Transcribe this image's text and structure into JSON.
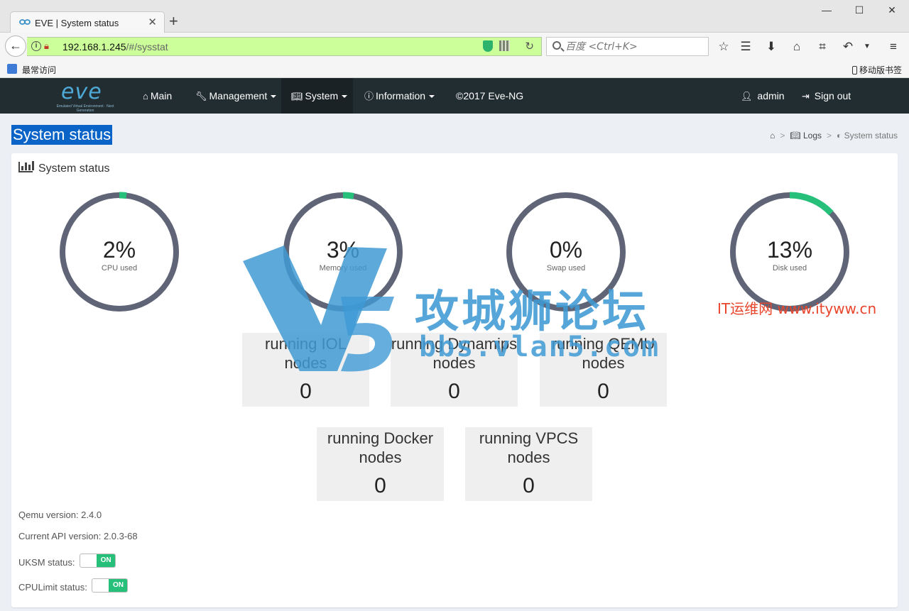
{
  "browser": {
    "tab_title": "EVE | System status",
    "url_host": "192.168.1.245",
    "url_path": "/#/sysstat",
    "search_placeholder": "百度 <Ctrl+K>",
    "bookmark_label": "最常访问",
    "mobile_bookmarks": "移动版书签"
  },
  "nav": {
    "main": "Main",
    "management": "Management",
    "system": "System",
    "information": "Information",
    "copyright": "©2017 Eve-NG",
    "user": "admin",
    "signout": "Sign out"
  },
  "page": {
    "title": "System status",
    "breadcrumb": {
      "logs": "Logs",
      "current": "System status"
    },
    "box_title": "System status"
  },
  "gauges": [
    {
      "value": "2%",
      "label": "CPU used",
      "percent": 2
    },
    {
      "value": "3%",
      "label": "Memory used",
      "percent": 3
    },
    {
      "value": "0%",
      "label": "Swap used",
      "percent": 0
    },
    {
      "value": "13%",
      "label": "Disk used",
      "percent": 13
    }
  ],
  "counters": [
    {
      "label": "running IOL nodes",
      "value": "0"
    },
    {
      "label": "running Dynamips nodes",
      "value": "0"
    },
    {
      "label": "running QEMU nodes",
      "value": "0"
    },
    {
      "label": "running Docker nodes",
      "value": "0"
    },
    {
      "label": "running VPCS nodes",
      "value": "0"
    }
  ],
  "info": {
    "qemu": "Qemu version: 2.4.0",
    "api": "Current API version: 2.0.3-68",
    "uksm_label": "UKSM status:",
    "cpulimit_label": "CPULimit status:",
    "toggle_on": "ON"
  },
  "watermark": {
    "title": "攻城狮论坛",
    "url": "bbs.vlan5.com",
    "right": "IT运维网 www.ityww.cn"
  },
  "colors": {
    "gauge_track": "#5f6577",
    "gauge_fill": "#27c07a",
    "nav_bg": "#222d32",
    "title_highlight": "#0a64c8"
  }
}
